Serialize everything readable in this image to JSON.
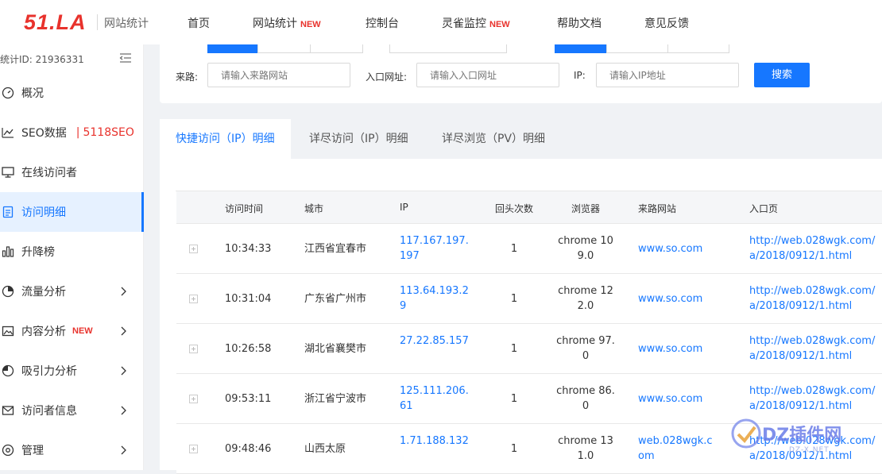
{
  "header": {
    "logo": "51.LA",
    "logo_sub": "网站统计",
    "nav": [
      {
        "label": "首页",
        "badge": ""
      },
      {
        "label": "网站统计",
        "badge": "NEW"
      },
      {
        "label": "控制台",
        "badge": ""
      },
      {
        "label": "灵雀监控",
        "badge": "NEW"
      },
      {
        "label": "帮助文档",
        "badge": ""
      },
      {
        "label": "意见反馈",
        "badge": ""
      }
    ]
  },
  "sidebar": {
    "stat_id": "统计ID: 21936331",
    "items": [
      {
        "label": "概况",
        "icon": "dashboard-icon"
      },
      {
        "label": "SEO数据",
        "icon": "trend-line-icon",
        "extra": "5118SEO"
      },
      {
        "label": "在线访问者",
        "icon": "monitor-icon"
      },
      {
        "label": "访问明细",
        "icon": "document-icon",
        "active": true
      },
      {
        "label": "升降榜",
        "icon": "bar-chart-icon"
      },
      {
        "label": "流量分析",
        "icon": "gauge-icon",
        "expandable": true
      },
      {
        "label": "内容分析",
        "icon": "image-icon",
        "badge": "NEW",
        "expandable": true
      },
      {
        "label": "吸引力分析",
        "icon": "pie-icon",
        "expandable": true
      },
      {
        "label": "访问者信息",
        "icon": "mail-icon",
        "expandable": true
      },
      {
        "label": "管理",
        "icon": "gear-icon",
        "expandable": true
      }
    ]
  },
  "filters": {
    "source_label": "来路:",
    "source_placeholder": "请输入来路网站",
    "entry_label": "入口网址:",
    "entry_placeholder": "请输入入口网址",
    "ip_label": "IP:",
    "ip_placeholder": "请输入IP地址",
    "search_button": "搜索"
  },
  "tabs": [
    {
      "label": "快捷访问（IP）明细",
      "active": true
    },
    {
      "label": "详尽访问（IP）明细",
      "active": false
    },
    {
      "label": "详尽浏览（PV）明细",
      "active": false
    }
  ],
  "table": {
    "columns": [
      "访问时间",
      "城市",
      "IP",
      "回头次数",
      "浏览器",
      "来路网站",
      "入口页"
    ],
    "rows": [
      {
        "time": "10:34:33",
        "city": "江西省宜春市",
        "ip": "117.167.197.197",
        "returns": "1",
        "browser": "chrome 109.0",
        "source": "www.so.com",
        "entry": "http://web.028wgk.com/a/2018/0912/1.html"
      },
      {
        "time": "10:31:04",
        "city": "广东省广州市",
        "ip": "113.64.193.29",
        "returns": "1",
        "browser": "chrome 122.0",
        "source": "www.so.com",
        "entry": "http://web.028wgk.com/a/2018/0912/1.html"
      },
      {
        "time": "10:26:58",
        "city": "湖北省襄樊市",
        "ip": "27.22.85.157",
        "returns": "1",
        "browser": "chrome 97.0",
        "source": "www.so.com",
        "entry": "http://web.028wgk.com/a/2018/0912/1.html"
      },
      {
        "time": "09:53:11",
        "city": "浙江省宁波市",
        "ip": "125.111.206.61",
        "returns": "1",
        "browser": "chrome 86.0",
        "source": "www.so.com",
        "entry": "http://web.028wgk.com/a/2018/0912/1.html"
      },
      {
        "time": "09:48:46",
        "city": "山西太原",
        "ip": "1.71.188.132",
        "returns": "1",
        "browser": "chrome 131.0",
        "source": "web.028wgk.com",
        "entry": "http://web.028wgk.com/a/2018/0912/1.html"
      }
    ]
  },
  "watermark": {
    "text": "DZ插件网",
    "sub": "DZ-X.NET"
  }
}
